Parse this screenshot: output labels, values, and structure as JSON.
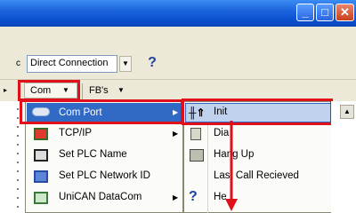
{
  "toolbar": {
    "connection_value": "Direct Connection",
    "help_label": "?"
  },
  "menubar": {
    "com_label": "Com",
    "fbs_label": "FB's"
  },
  "menu": {
    "items": [
      {
        "label": "Com Port",
        "icon": "com-port-icon",
        "submenu": true
      },
      {
        "label": "TCP/IP",
        "icon": "network-icon",
        "submenu": true
      },
      {
        "label": "Set PLC Name",
        "icon": "plc-name-icon",
        "submenu": false
      },
      {
        "label": "Set PLC Network ID",
        "icon": "network-id-icon",
        "submenu": false
      },
      {
        "label": "UniCAN DataCom",
        "icon": "datacom-icon",
        "submenu": true
      }
    ]
  },
  "submenu": {
    "items": [
      {
        "label": "Init",
        "icon": "init-icon"
      },
      {
        "label": "Dia",
        "icon": "dial-icon"
      },
      {
        "label": "Hang Up",
        "icon": "hang-up-icon"
      },
      {
        "label": "Last Call Recieved",
        "icon": ""
      },
      {
        "label": "He",
        "icon": "help-icon"
      }
    ]
  },
  "colors": {
    "highlight": "#e0101a",
    "titlebar": "#0a4fd0",
    "selected_item": "#316ac5"
  }
}
